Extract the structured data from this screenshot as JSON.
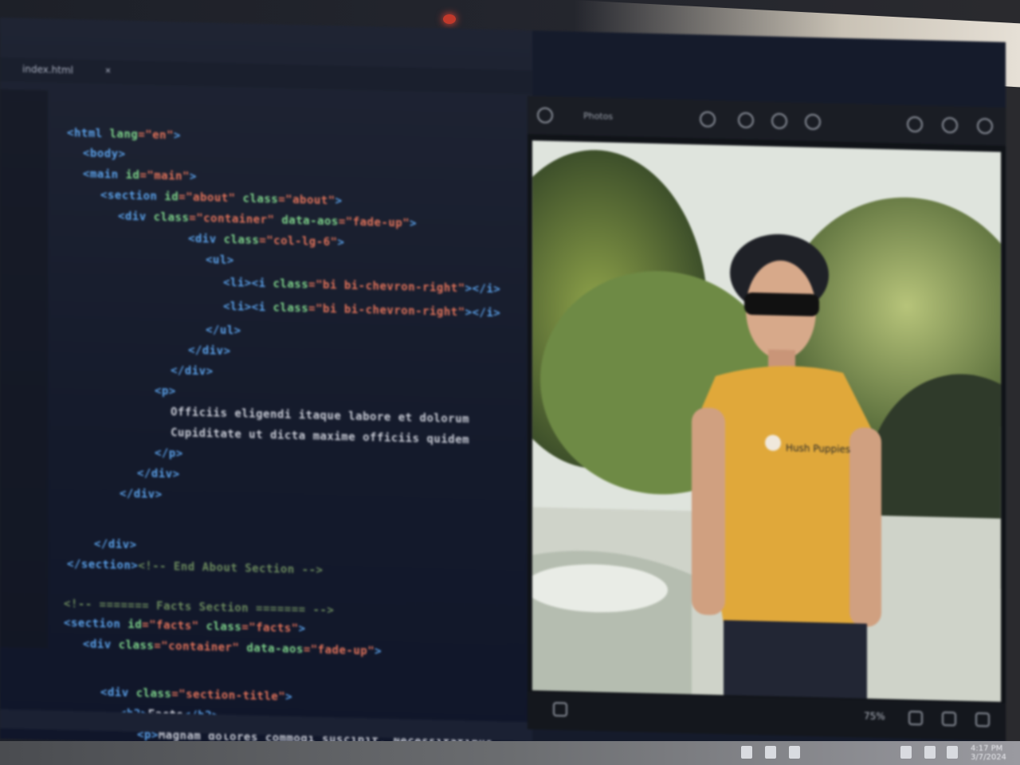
{
  "editor": {
    "tab_label": "index.html",
    "tab_close": "×",
    "lines": [
      {
        "seg": [
          [
            "<html ",
            "tag"
          ],
          [
            "lang",
            "a"
          ],
          [
            "=\"en\"",
            "s"
          ],
          [
            ">",
            "tag"
          ]
        ]
      },
      {
        "seg": [
          [
            "<body>",
            "tag"
          ]
        ]
      },
      {
        "seg": [
          [
            "<main ",
            "tag"
          ],
          [
            "id",
            "a"
          ],
          [
            "=\"main\"",
            "s"
          ],
          [
            ">",
            "tag"
          ]
        ]
      },
      {
        "seg": [
          [
            "<section ",
            "tag"
          ],
          [
            "id",
            "a"
          ],
          [
            "=\"about\" ",
            "s"
          ],
          [
            "class",
            "a"
          ],
          [
            "=\"about\"",
            "s"
          ],
          [
            ">",
            "tag"
          ]
        ]
      },
      {
        "seg": [
          [
            "<div ",
            "tag"
          ],
          [
            "class",
            "a"
          ],
          [
            "=\"container\" ",
            "s"
          ],
          [
            "data-aos",
            "a"
          ],
          [
            "=\"fade-up\"",
            "s"
          ],
          [
            ">",
            "tag"
          ]
        ]
      },
      {
        "seg": [
          [
            "<div ",
            "tag"
          ],
          [
            "class",
            "a"
          ],
          [
            "=\"col-lg-6\"",
            "s"
          ],
          [
            ">",
            "tag"
          ]
        ]
      },
      {
        "seg": [
          [
            "<ul>",
            "tag"
          ]
        ]
      },
      {
        "seg": [
          [
            "<li><i ",
            "tag"
          ],
          [
            "class",
            "a"
          ],
          [
            "=\"bi bi-chevron-right\"",
            "s"
          ],
          [
            "></i>",
            "tag"
          ]
        ]
      },
      {
        "seg": [
          [
            "<li><i ",
            "tag"
          ],
          [
            "class",
            "a"
          ],
          [
            "=\"bi bi-chevron-right\"",
            "s"
          ],
          [
            "></i>",
            "tag"
          ]
        ]
      },
      {
        "seg": [
          [
            "</ul>",
            "tag"
          ]
        ]
      },
      {
        "seg": [
          [
            "</div>",
            "tag"
          ]
        ]
      },
      {
        "seg": [
          [
            "</div>",
            "tag"
          ]
        ]
      },
      {
        "seg": [
          [
            "<p>",
            "tag"
          ]
        ]
      },
      {
        "seg": [
          [
            "Officiis eligendi itaque labore et dolorum",
            "p"
          ]
        ]
      },
      {
        "seg": [
          [
            "Cupiditate ut dicta maxime officiis quidem",
            "p"
          ]
        ]
      },
      {
        "seg": [
          [
            "</p>",
            "tag"
          ]
        ]
      },
      {
        "seg": [
          [
            "</div>",
            "tag"
          ]
        ]
      },
      {
        "seg": [
          [
            "</div>",
            "tag"
          ]
        ]
      },
      {
        "seg": [
          [
            "</div>",
            "tag"
          ]
        ]
      },
      {
        "seg": [
          [
            "</section>",
            "tag"
          ],
          [
            "<!-- End About Section -->",
            "c"
          ]
        ]
      },
      {
        "seg": [
          [
            "<!-- ======= Facts Section ======= -->",
            "c"
          ]
        ]
      },
      {
        "seg": [
          [
            "<section ",
            "tag"
          ],
          [
            "id",
            "a"
          ],
          [
            "=\"facts\" ",
            "s"
          ],
          [
            "class",
            "a"
          ],
          [
            "=\"facts\"",
            "s"
          ],
          [
            ">",
            "tag"
          ]
        ]
      },
      {
        "seg": [
          [
            "<div ",
            "tag"
          ],
          [
            "class",
            "a"
          ],
          [
            "=\"container\" ",
            "s"
          ],
          [
            "data-aos",
            "a"
          ],
          [
            "=\"fade-up\"",
            "s"
          ],
          [
            ">",
            "tag"
          ]
        ]
      },
      {
        "seg": [
          [
            "<div ",
            "tag"
          ],
          [
            "class",
            "a"
          ],
          [
            "=\"section-title\"",
            "s"
          ],
          [
            ">",
            "tag"
          ]
        ]
      },
      {
        "seg": [
          [
            "<h2>",
            "tag"
          ],
          [
            "Facts",
            "p"
          ],
          [
            "</h2>",
            "tag"
          ]
        ]
      },
      {
        "seg": [
          [
            "<p>",
            "tag"
          ],
          [
            "Magnam dolores commodi suscipit. Necessitatibus",
            "p"
          ]
        ]
      }
    ]
  },
  "photo_app": {
    "title": "Photos",
    "zoom": "75%",
    "shirt_text": "Hush Puppies"
  },
  "taskbar": {
    "time": "4:17 PM",
    "date": "3/7/2024"
  },
  "colors": {
    "tag": "#5aa0e8",
    "attr": "#7fd48b",
    "string": "#e2735a",
    "comment": "#6c8a5e",
    "shirt": "#e0a83a"
  }
}
